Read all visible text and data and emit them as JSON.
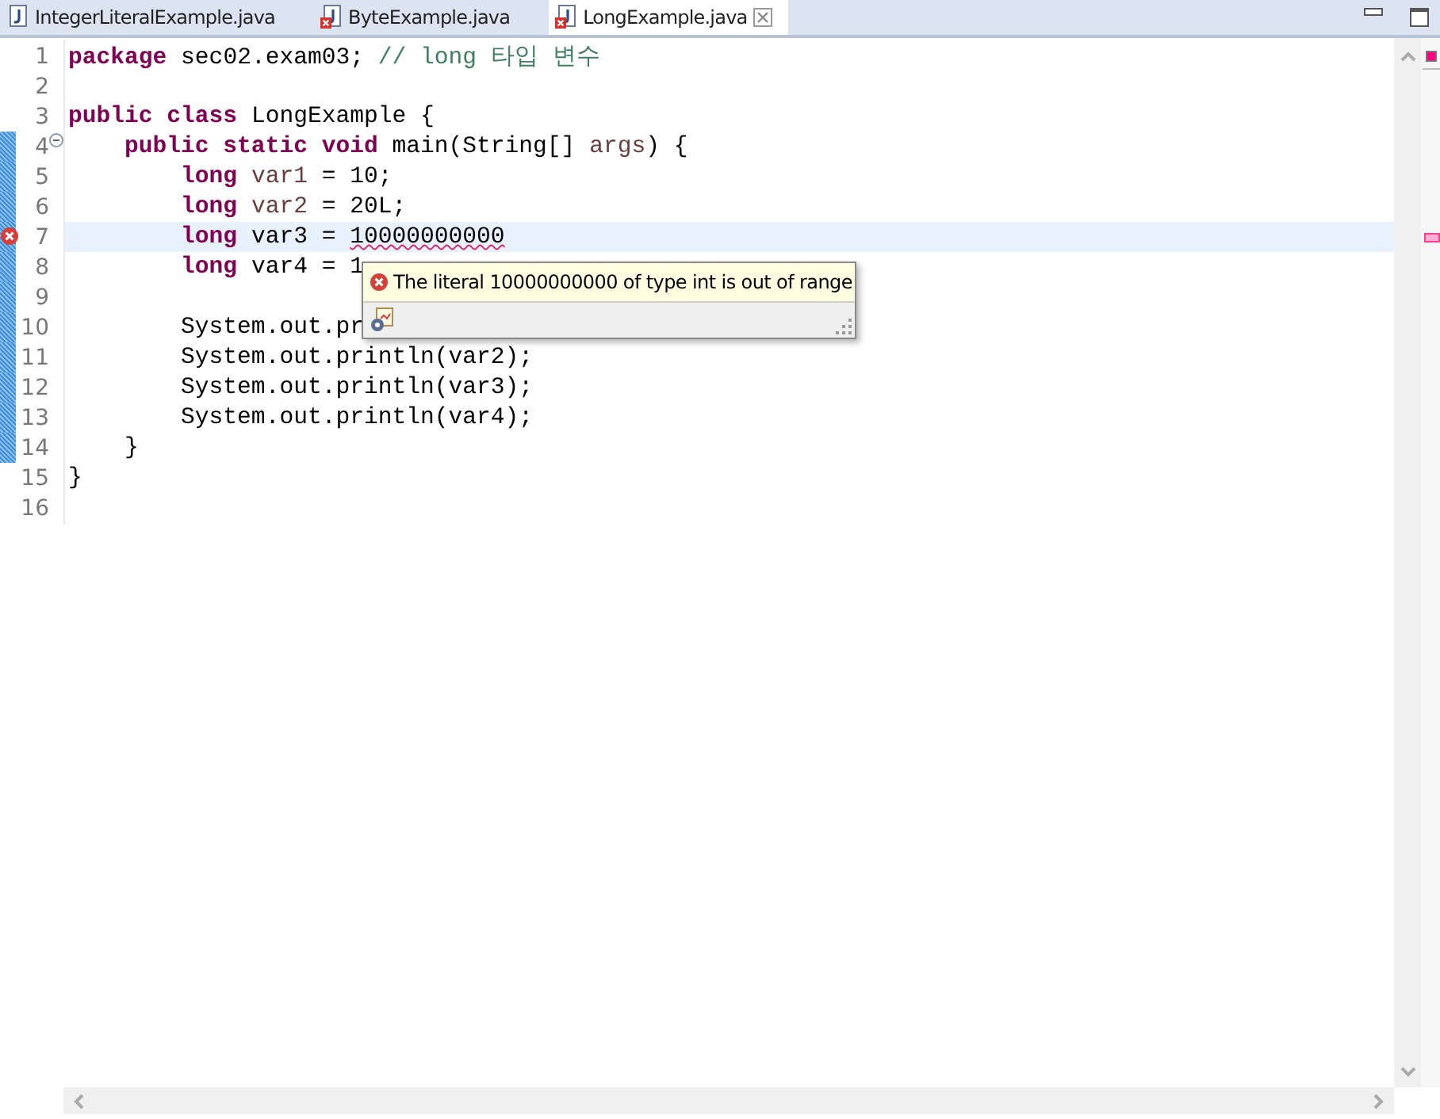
{
  "tabs": [
    {
      "label": "IntegerLiteralExample.java",
      "selected": false,
      "error": false
    },
    {
      "label": "ByteExample.java",
      "selected": false,
      "error": true
    },
    {
      "label": "LongExample.java",
      "selected": true,
      "error": true
    }
  ],
  "lines": [
    {
      "number": "1",
      "tokens": [
        {
          "kind": "keyword",
          "text": "package"
        },
        {
          "kind": "plain",
          "text": " sec02.exam03; "
        },
        {
          "kind": "comment",
          "text": "// long 타입 변수"
        }
      ]
    },
    {
      "number": "2"
    },
    {
      "number": "3",
      "tokens": [
        {
          "kind": "keyword",
          "text": "public class"
        },
        {
          "kind": "plain",
          "text": " LongExample {"
        }
      ]
    },
    {
      "number": "4",
      "fold": true,
      "changed": true,
      "tokens": [
        {
          "kind": "keyword",
          "text": "    public static void"
        },
        {
          "kind": "plain",
          "text": " main(String[] "
        },
        {
          "kind": "var",
          "text": "args"
        },
        {
          "kind": "plain",
          "text": ") {"
        }
      ]
    },
    {
      "number": "5",
      "changed": true,
      "tokens": [
        {
          "kind": "keyword",
          "text": "        long"
        },
        {
          "kind": "var",
          "text": " var1"
        },
        {
          "kind": "plain",
          "text": " = 10;"
        }
      ]
    },
    {
      "number": "6",
      "changed": true,
      "tokens": [
        {
          "kind": "keyword",
          "text": "        long"
        },
        {
          "kind": "var",
          "text": " var2"
        },
        {
          "kind": "plain",
          "text": " = 20L;"
        }
      ]
    },
    {
      "number": "7",
      "changed": true,
      "error": true,
      "current": true,
      "tokens": [
        {
          "kind": "keyword",
          "text": "        long"
        },
        {
          "kind": "plain",
          "text": " var3 = "
        },
        {
          "kind": "error",
          "text": "10000000000"
        }
      ]
    },
    {
      "number": "8",
      "changed": true,
      "tokens": [
        {
          "kind": "keyword",
          "text": "        long"
        },
        {
          "kind": "plain",
          "text": " var4 = 1"
        }
      ]
    },
    {
      "number": "9",
      "changed": true
    },
    {
      "number": "10",
      "changed": true,
      "tokens": [
        {
          "kind": "plain",
          "text": "        System.out.pr"
        }
      ]
    },
    {
      "number": "11",
      "changed": true,
      "tokens": [
        {
          "kind": "plain",
          "text": "        System.out.println(var2);"
        }
      ]
    },
    {
      "number": "12",
      "changed": true,
      "tokens": [
        {
          "kind": "plain",
          "text": "        System.out.println(var3);"
        }
      ]
    },
    {
      "number": "13",
      "changed": true,
      "tokens": [
        {
          "kind": "plain",
          "text": "        System.out.println(var4);"
        }
      ]
    },
    {
      "number": "14",
      "changed": true,
      "tokens": [
        {
          "kind": "plain",
          "text": "    }"
        }
      ]
    },
    {
      "number": "15",
      "tokens": [
        {
          "kind": "plain",
          "text": "}"
        }
      ]
    },
    {
      "number": "16"
    }
  ],
  "tooltip": {
    "message": "The literal 10000000000 of type int is out of range"
  }
}
